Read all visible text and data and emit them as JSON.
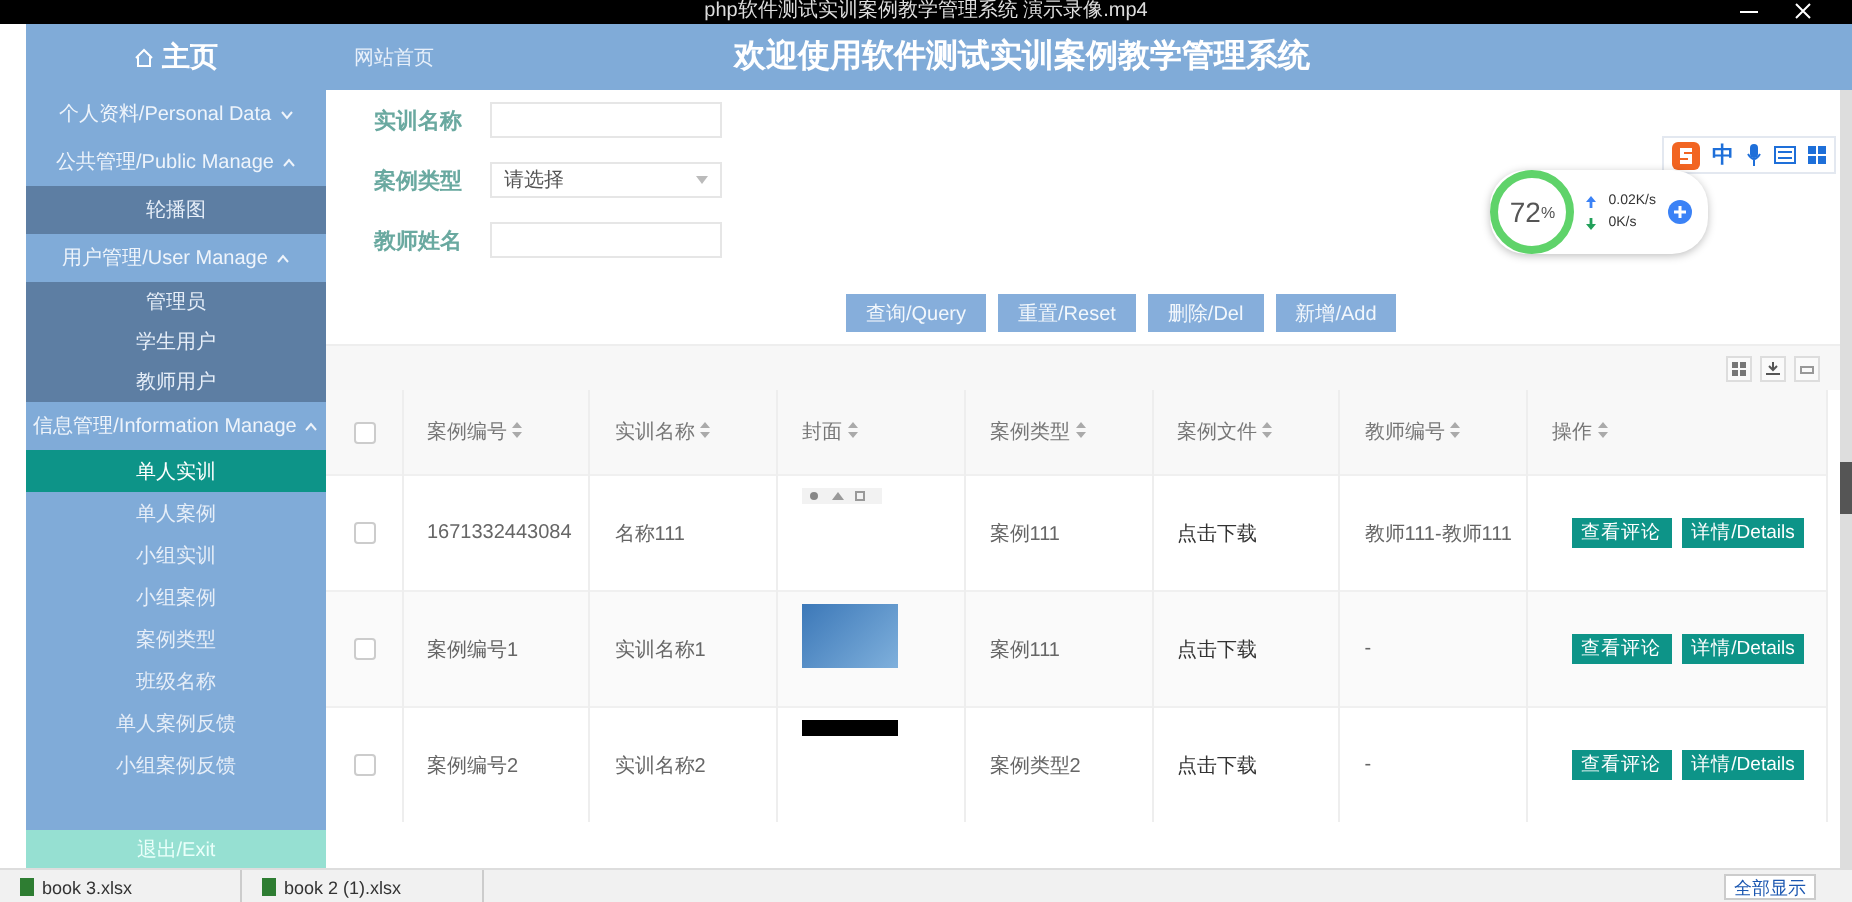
{
  "video_title": "php软件测试实训案例教学管理系统 演示录像.mp4",
  "header": {
    "home": "主页",
    "breadcrumb": "网站首页",
    "title": "欢迎使用软件测试实训案例教学管理系统"
  },
  "sidebar": {
    "groups": [
      {
        "label": "个人资料/Personal Data",
        "expanded": false
      },
      {
        "label": "公共管理/Public Manage",
        "expanded": true,
        "children": [
          {
            "label": "轮播图",
            "selected": false
          }
        ]
      },
      {
        "label": "用户管理/User Manage",
        "expanded": true,
        "children": [
          {
            "label": "管理员",
            "selected": false
          },
          {
            "label": "学生用户",
            "selected": false
          },
          {
            "label": "教师用户",
            "selected": false
          }
        ]
      },
      {
        "label": "信息管理/Information Manage",
        "expanded": true,
        "children": [
          {
            "label": "单人实训",
            "selected": true
          },
          {
            "label": "单人案例",
            "selected": false
          },
          {
            "label": "小组实训",
            "selected": false
          },
          {
            "label": "小组案例",
            "selected": false
          },
          {
            "label": "案例类型",
            "selected": false
          },
          {
            "label": "班级名称",
            "selected": false
          },
          {
            "label": "单人案例反馈",
            "selected": false
          },
          {
            "label": "小组案例反馈",
            "selected": false
          }
        ]
      }
    ],
    "exit": "退出/Exit"
  },
  "search_form": {
    "fields": [
      {
        "label": "实训名称",
        "kind": "text"
      },
      {
        "label": "案例类型",
        "kind": "select",
        "placeholder": "请选择"
      },
      {
        "label": "教师姓名",
        "kind": "text"
      }
    ]
  },
  "buttons": [
    "查询/Query",
    "重置/Reset",
    "删除/Del",
    "新增/Add"
  ],
  "table": {
    "all_selected": false,
    "columns": [
      "案例编号",
      "实训名称",
      "封面",
      "案例类型",
      "案例文件",
      "教师编号",
      "操作"
    ],
    "rows": [
      {
        "selected": false,
        "case_no": "1671332443084",
        "name": "名称111",
        "kind": "broken-image",
        "type": "案例111",
        "file": "点击下载",
        "teacher": "教师111-教师111",
        "actions": [
          "查看评论",
          "详情/Details"
        ]
      },
      {
        "selected": false,
        "case_no": "案例编号1",
        "name": "实训名称1",
        "kind": "photo",
        "type": "案例111",
        "file": "点击下载",
        "teacher": "-",
        "actions": [
          "查看评论",
          "详情/Details"
        ]
      },
      {
        "selected": false,
        "case_no": "案例编号2",
        "name": "实训名称2",
        "kind": "dark-image",
        "type": "案例类型2",
        "file": "点击下载",
        "teacher": "-",
        "actions": [
          "查看评论",
          "详情/Details"
        ]
      }
    ]
  },
  "ime_toolbar": {
    "label": "中"
  },
  "speed_widget": {
    "percent": "72",
    "unit": "%",
    "up": "0.02K/s",
    "down": "0K/s"
  },
  "downloads": {
    "files": [
      "book 3.xlsx",
      "book 2 (1).xlsx"
    ],
    "show_all": "全部显示"
  }
}
